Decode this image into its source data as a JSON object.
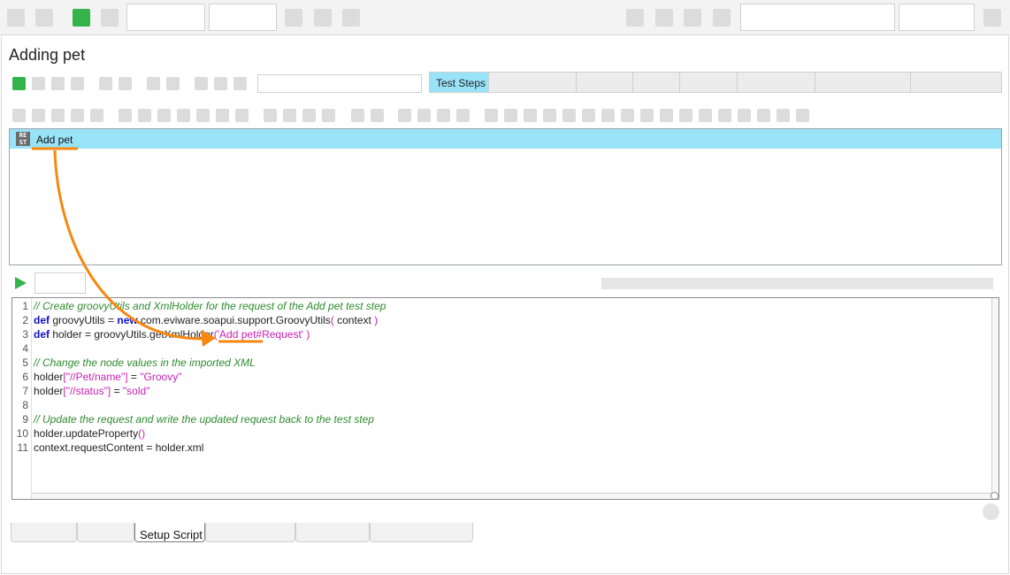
{
  "window": {
    "panel_title": "Adding pet"
  },
  "tabs": {
    "items": [
      {
        "label": "Test Steps",
        "selected": true
      },
      {
        "label": ""
      },
      {
        "label": ""
      },
      {
        "label": ""
      },
      {
        "label": ""
      },
      {
        "label": ""
      },
      {
        "label": ""
      },
      {
        "label": ""
      }
    ]
  },
  "steps": {
    "items": [
      {
        "badge_top": "RE",
        "badge_bottom": "ST",
        "label": "Add pet",
        "selected": true
      }
    ]
  },
  "editor": {
    "lines": [
      {
        "num": "1",
        "tokens": [
          {
            "c": "cm",
            "t": "// Create groovyUtils and XmlHolder for the request of the Add pet test step"
          }
        ]
      },
      {
        "num": "2",
        "tokens": [
          {
            "c": "kw",
            "t": "def"
          },
          {
            "c": "df",
            "t": " groovyUtils = "
          },
          {
            "c": "kw",
            "t": "new"
          },
          {
            "c": "df",
            "t": " com.eviware.soapui.support.GroovyUtils"
          },
          {
            "c": "st",
            "t": "("
          },
          {
            "c": "df",
            "t": " context "
          },
          {
            "c": "st",
            "t": ")"
          }
        ]
      },
      {
        "num": "3",
        "tokens": [
          {
            "c": "kw",
            "t": "def"
          },
          {
            "c": "df",
            "t": " holder = groovyUtils.getXmlHolder"
          },
          {
            "c": "st",
            "t": "('Add pet#Request' )"
          }
        ]
      },
      {
        "num": "4",
        "tokens": []
      },
      {
        "num": "5",
        "tokens": [
          {
            "c": "cm",
            "t": "// Change the node values in the imported XML"
          }
        ]
      },
      {
        "num": "6",
        "tokens": [
          {
            "c": "df",
            "t": "holder"
          },
          {
            "c": "st",
            "t": "[\"//Pet/name\"]"
          },
          {
            "c": "df",
            "t": " = "
          },
          {
            "c": "st",
            "t": "\"Groovy\""
          }
        ]
      },
      {
        "num": "7",
        "tokens": [
          {
            "c": "df",
            "t": "holder"
          },
          {
            "c": "st",
            "t": "[\"//status\"]"
          },
          {
            "c": "df",
            "t": " = "
          },
          {
            "c": "st",
            "t": "\"sold\""
          }
        ]
      },
      {
        "num": "8",
        "tokens": []
      },
      {
        "num": "9",
        "tokens": [
          {
            "c": "cm",
            "t": "// Update the request and write the updated request back to the test step"
          }
        ]
      },
      {
        "num": "10",
        "tokens": [
          {
            "c": "df",
            "t": "holder.updateProperty"
          },
          {
            "c": "st",
            "t": "()"
          }
        ]
      },
      {
        "num": "11",
        "tokens": [
          {
            "c": "df",
            "t": "context.requestContent = holder.xml"
          }
        ]
      }
    ]
  },
  "bottom_tabs": {
    "items": [
      {
        "label": ""
      },
      {
        "label": ""
      },
      {
        "label": "Setup Script",
        "selected": true
      },
      {
        "label": ""
      },
      {
        "label": ""
      },
      {
        "label": ""
      }
    ]
  },
  "colors": {
    "selection": "#99e3f8",
    "accent_orange": "#f7870f",
    "run_green": "#34b34a",
    "comment": "#2e8b2e",
    "keyword": "#1010c8",
    "string": "#c81fb5"
  }
}
